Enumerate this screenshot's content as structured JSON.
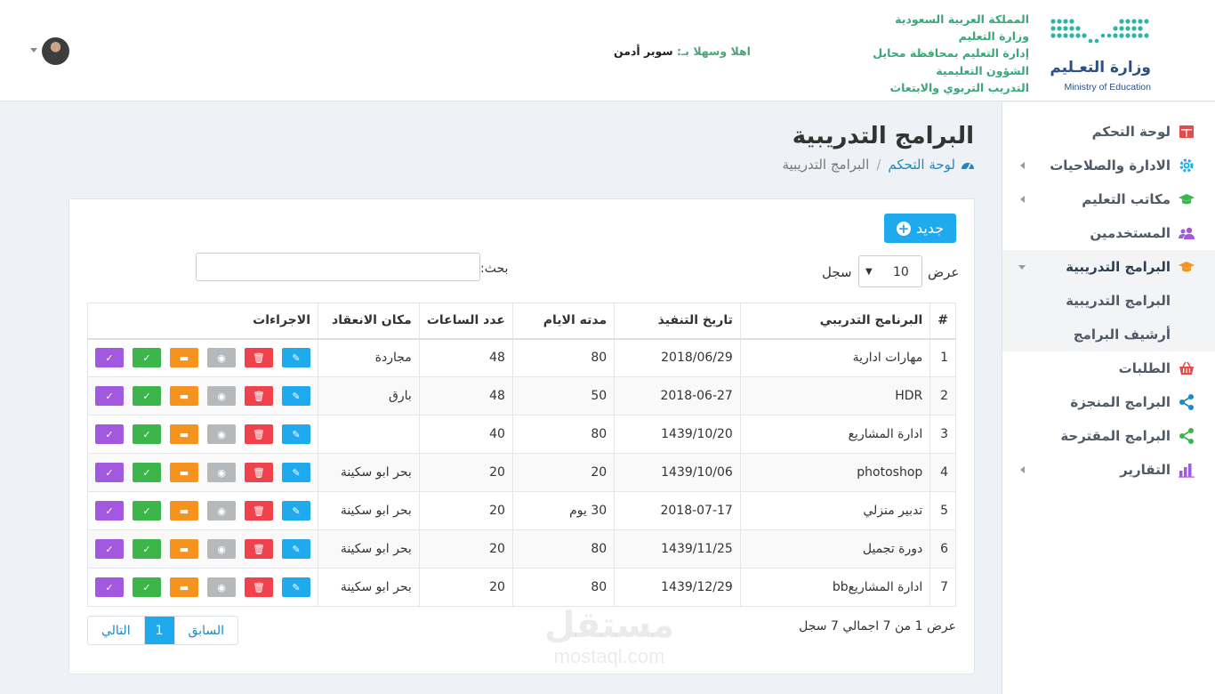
{
  "header": {
    "logo_ar": "وزارة التعـليم",
    "logo_en": "Ministry of Education",
    "dept_lines": [
      "المملكة العربية السعودية",
      "وزارة التعليم",
      "إدارة التعليم بمحافظة محايل",
      "الشؤون التعليمية",
      "التدريب التربوي والابتعاث"
    ],
    "welcome_text": "اهلا وسهلا بـ:",
    "welcome_user": "سوبر أدمن"
  },
  "sidebar": {
    "items": [
      {
        "label": "لوحة التحكم",
        "icon": "dashboard-icon",
        "color": "#e44b4b"
      },
      {
        "label": "الادارة والصلاحيات",
        "icon": "gear-icon",
        "color": "#1faaee"
      },
      {
        "label": "مكاتب التعليم",
        "icon": "graduation-cap-icon",
        "color": "#3cb54a"
      },
      {
        "label": "المستخدمين",
        "icon": "users-icon",
        "color": "#a259e0"
      },
      {
        "label": "البرامج التدريبية",
        "icon": "graduation-cap-icon",
        "color": "#f5931f"
      },
      {
        "label": "الطلبات",
        "icon": "basket-icon",
        "color": "#e44b4b"
      },
      {
        "label": "البرامج المنجزة",
        "icon": "share-icon",
        "color": "#1e88c8"
      },
      {
        "label": "البرامج المقترحة",
        "icon": "share-icon",
        "color": "#3cb54a"
      },
      {
        "label": "التقارير",
        "icon": "bar-chart-icon",
        "color": "#a259e0"
      }
    ],
    "subitems": [
      "البرامج التدريبية",
      "أرشيف البرامج"
    ]
  },
  "page": {
    "title": "البرامج التدريبية",
    "breadcrumb_home": "لوحة التحكم",
    "breadcrumb_sep": "/",
    "breadcrumb_current": "البرامج التدريبية"
  },
  "toolbar": {
    "new_label": "جديد",
    "show_label": "عرض",
    "page_size": "10",
    "records_label": "سجل",
    "search_label": "بحث:"
  },
  "table": {
    "headers": [
      "#",
      "البرنامج التدريبي",
      "تاريخ التنفيذ",
      "مدته الايام",
      "عدد الساعات",
      "مكان الانعقاد",
      "الاجراءات"
    ],
    "rows": [
      [
        "1",
        "مهارات ادارية",
        "2018/06/29",
        "80",
        "48",
        "مجاردة"
      ],
      [
        "2",
        "HDR",
        "2018-06-27",
        "50",
        "48",
        "بارق"
      ],
      [
        "3",
        "ادارة المشاريع",
        "1439/10/20",
        "80",
        "40",
        ""
      ],
      [
        "4",
        "photoshop",
        "1439/10/06",
        "20",
        "20",
        "بحر ابو سكينة"
      ],
      [
        "5",
        "تدبير منزلي",
        "2018-07-17",
        "30 يوم",
        "20",
        "بحر ابو سكينة"
      ],
      [
        "6",
        "دورة تجميل",
        "1439/11/25",
        "80",
        "20",
        "بحر ابو سكينة"
      ],
      [
        "7",
        "ادارة المشاريعbb",
        "1439/12/29",
        "80",
        "20",
        "بحر ابو سكينة"
      ]
    ],
    "row_actions": [
      "edit-icon",
      "trash-icon",
      "eye-icon",
      "archive-icon",
      "check-icon",
      "check-icon"
    ]
  },
  "footer": {
    "info": "عرض 1 من 7 اجمالي 7 سجل",
    "prev": "السابق",
    "current_page": "1",
    "next": "التالي"
  },
  "watermark": {
    "ar": "مستقل",
    "en": "mostaql.com"
  }
}
